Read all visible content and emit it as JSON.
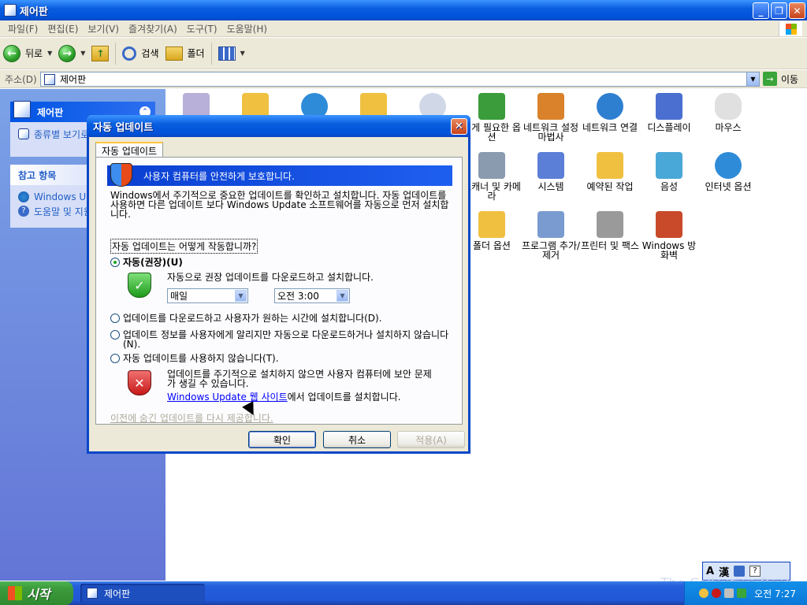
{
  "window": {
    "title": "제어판",
    "minimize": "_",
    "restore": "❐",
    "close": "✕"
  },
  "menu": [
    "파일(F)",
    "편집(E)",
    "보기(V)",
    "즐겨찾기(A)",
    "도구(T)",
    "도움말(H)"
  ],
  "toolbar": {
    "back": "뒤로",
    "search": "검색",
    "folders": "폴더"
  },
  "address": {
    "label": "주소(D)",
    "value": "제어판",
    "go": "이동"
  },
  "left_panel": {
    "panel1": {
      "title": "제어판",
      "link": "종류별 보기로 전환"
    },
    "panel2": {
      "title": "참고 항목",
      "links": [
        "Windows Update",
        "도움말 및 지원"
      ]
    }
  },
  "control_panel_items": [
    {
      "label": ""
    },
    {
      "label": ""
    },
    {
      "label": ""
    },
    {
      "label": ""
    },
    {
      "label": ""
    },
    {
      "label": "내게 필요한 옵션",
      "color": "#3a9c3a"
    },
    {
      "label": "네트워크 설정 마법사",
      "color": "#d9822b"
    },
    {
      "label": "네트워크 연결",
      "color": "#2f7fd1"
    },
    {
      "label": "디스플레이",
      "color": "#4a6fd0"
    },
    {
      "label": "마우스",
      "color": "#bdbdbd"
    },
    {
      "label": "스캐너 및 카메라",
      "color": "#8a9bb0"
    },
    {
      "label": "시스템",
      "color": "#5b7fd6"
    },
    {
      "label": "예약된 작업",
      "color": "#f0c040"
    },
    {
      "label": "음성",
      "color": "#4aa8d8"
    },
    {
      "label": "인터넷 옵션",
      "color": "#2e8bd8"
    },
    {
      "label": "폴더 옵션",
      "color": "#f0c040"
    },
    {
      "label": "프로그램 추가/제거",
      "color": "#7a9bd0"
    },
    {
      "label": "프린터 및 팩스",
      "color": "#9a9a9a"
    },
    {
      "label": "Windows 방화벽",
      "color": "#c84a2a"
    }
  ],
  "dialog": {
    "title": "자동 업데이트",
    "tab": "자동 업데이트",
    "banner": "사용자 컴퓨터를 안전하게 보호합니다.",
    "description": "Windows에서 주기적으로 중요한 업데이트를 확인하고 설치합니다. 자동 업데이트를 사용하면 다른 업데이트 보다 Windows Update 소프트웨어를 자동으로 먼저 설치합니다.",
    "how_link": "자동 업데이트는 어떻게 작동합니까?",
    "option_auto": "자동(권장)(U)",
    "option_auto_desc": "자동으로 권장 업데이트를 다운로드하고 설치합니다.",
    "day_select": "매일",
    "time_select": "오전 3:00",
    "option_download": "업데이트를 다운로드하고 사용자가 원하는 시간에 설치합니다(D).",
    "option_notify": "업데이트 정보를 사용자에게 알리지만 자동으로 다운로드하거나 설치하지 않습니다(N).",
    "option_off": "자동 업데이트를 사용하지 않습니다(T).",
    "warning_text": "업데이트를 주기적으로 설치하지 않으면 사용자 컴퓨터에 보안 문제가 생길 수 있습니다.",
    "wu_link": "Windows Update 웹 사이트",
    "wu_suffix": "에서 업데이트를 설치합니다.",
    "hidden_link": "이전에 숨긴 업데이트를 다시 제공합니다.",
    "ok": "확인",
    "cancel": "취소",
    "apply": "적용(A)"
  },
  "taskbar": {
    "start": "시작",
    "task": "제어판",
    "clock": "오전 7:27"
  },
  "langbar": {
    "a": "A",
    "han": "漢",
    "help": "?"
  },
  "watermark": "The Collection Book"
}
